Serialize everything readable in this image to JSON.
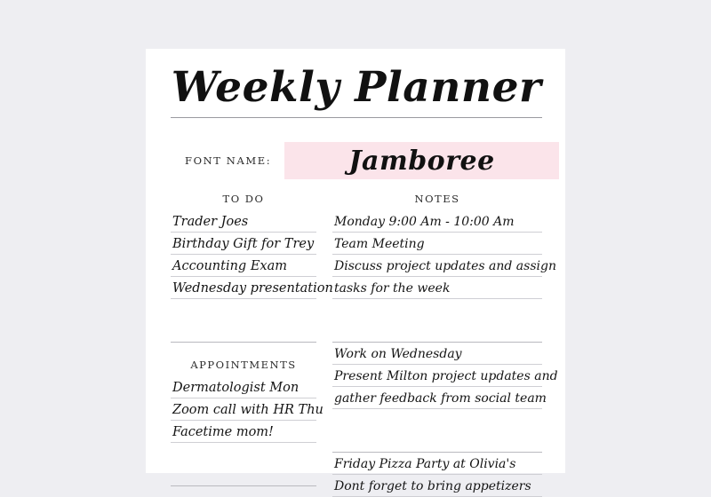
{
  "page": {
    "title": "Weekly Planner",
    "background_color": "#eeeef2",
    "sheet_color": "#ffffff",
    "rule_color": "#cfcfd4"
  },
  "font_name_row": {
    "label": "FONT NAME:",
    "value": "Jamboree",
    "highlight_color": "#fbe4ea"
  },
  "todo": {
    "heading": "TO DO",
    "items": [
      "Trader Joes",
      "Birthday Gift for Trey",
      "Accounting Exam",
      "Wednesday presentation",
      "",
      ""
    ]
  },
  "appointments": {
    "heading": "APPOINTMENTS",
    "items": [
      "Dermatologist Mon",
      "Zoom call with HR Thu",
      "Facetime mom!",
      "",
      ""
    ]
  },
  "notes": {
    "heading": "NOTES",
    "lines": [
      "Monday 9:00 Am - 10:00 Am",
      "Team Meeting",
      "Discuss project updates and assign",
      "tasks for the week",
      "",
      "",
      "Work on Wednesday",
      "Present Milton project updates and",
      "gather feedback from social team",
      "",
      "",
      "Friday Pizza Party at Olivia's",
      "Dont forget to bring appetizers"
    ]
  }
}
